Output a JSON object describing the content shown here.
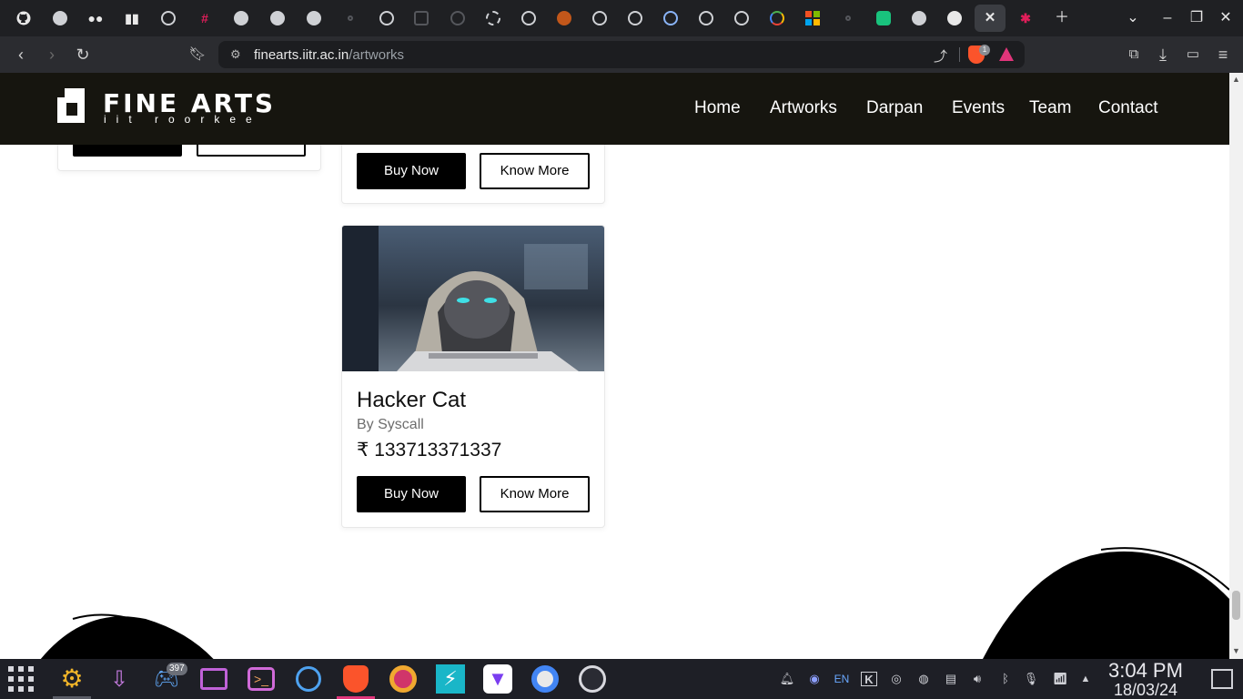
{
  "browser": {
    "url_host": "finearts.iitr.ac.in",
    "url_path": "/artworks",
    "brave_badge_count": "1",
    "tabs": [
      {
        "icon": "github-icon"
      },
      {
        "icon": "globe-icon"
      },
      {
        "icon": "medium-icon"
      },
      {
        "icon": "book-icon"
      },
      {
        "icon": "openai-icon"
      },
      {
        "icon": "slack-icon"
      },
      {
        "icon": "globe-icon"
      },
      {
        "icon": "globe-icon"
      },
      {
        "icon": "globe-icon"
      },
      {
        "icon": "dot-icon"
      },
      {
        "icon": "github-icon"
      },
      {
        "icon": "notion-icon"
      },
      {
        "icon": "x-icon"
      },
      {
        "icon": "circle-icon"
      },
      {
        "icon": "openai-icon"
      },
      {
        "icon": "avatar-icon"
      },
      {
        "icon": "github-icon"
      },
      {
        "icon": "github-icon"
      },
      {
        "icon": "compass-icon"
      },
      {
        "icon": "github-icon"
      },
      {
        "icon": "github-icon"
      },
      {
        "icon": "google-icon"
      },
      {
        "icon": "microsoft-icon"
      },
      {
        "icon": "dot-icon"
      },
      {
        "icon": "chatgpt-icon"
      },
      {
        "icon": "globe-icon"
      },
      {
        "icon": "github-icon"
      },
      {
        "icon": "close-icon"
      },
      {
        "icon": "slack-icon"
      }
    ]
  },
  "site": {
    "logo_title": "FINE ARTS",
    "logo_subtitle": "iit roorkee",
    "nav": [
      "Home",
      "Artworks",
      "Darpan",
      "Events",
      "Team",
      "Contact"
    ]
  },
  "artworks": {
    "buy_label": "Buy Now",
    "more_label": "Know More",
    "featured": {
      "title": "Hacker Cat",
      "artist": "By Syscall",
      "price": "₹ 133713371337"
    }
  },
  "taskbar": {
    "notification_badge": "397",
    "tray_lang": "EN",
    "time": "3:04 PM",
    "date": "18/03/24",
    "colors": {
      "bg": "#1e1f26",
      "accent": "#e0357a"
    }
  }
}
